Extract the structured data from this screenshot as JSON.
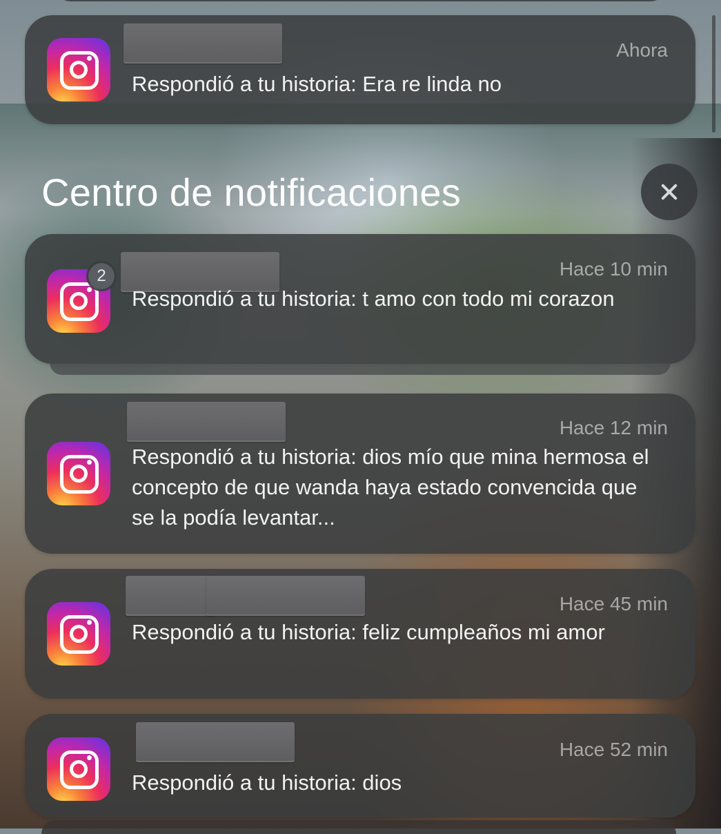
{
  "banner": {
    "app_icon": "instagram-icon",
    "time": "Ahora",
    "message": "Respondió a tu historia: Era re linda no"
  },
  "notification_center": {
    "title": "Centro de notificaciones",
    "close_icon": "close-icon"
  },
  "notifications": [
    {
      "app_icon": "instagram-icon",
      "badge": "2",
      "time": "Hace 10 min",
      "message": "Respondió a tu historia: t amo con todo mi corazon"
    },
    {
      "app_icon": "instagram-icon",
      "time": "Hace 12 min",
      "message": "Respondió a tu historia: dios mío que mina hermosa el concepto de que wanda haya estado convencida que se la podía levantar..."
    },
    {
      "app_icon": "instagram-icon",
      "time": "Hace 45 min",
      "message": "Respondió a tu historia: feliz cumpleaños mi amor"
    },
    {
      "app_icon": "instagram-icon",
      "time": "Hace 52 min",
      "message": "Respondió a tu historia: dios"
    }
  ]
}
